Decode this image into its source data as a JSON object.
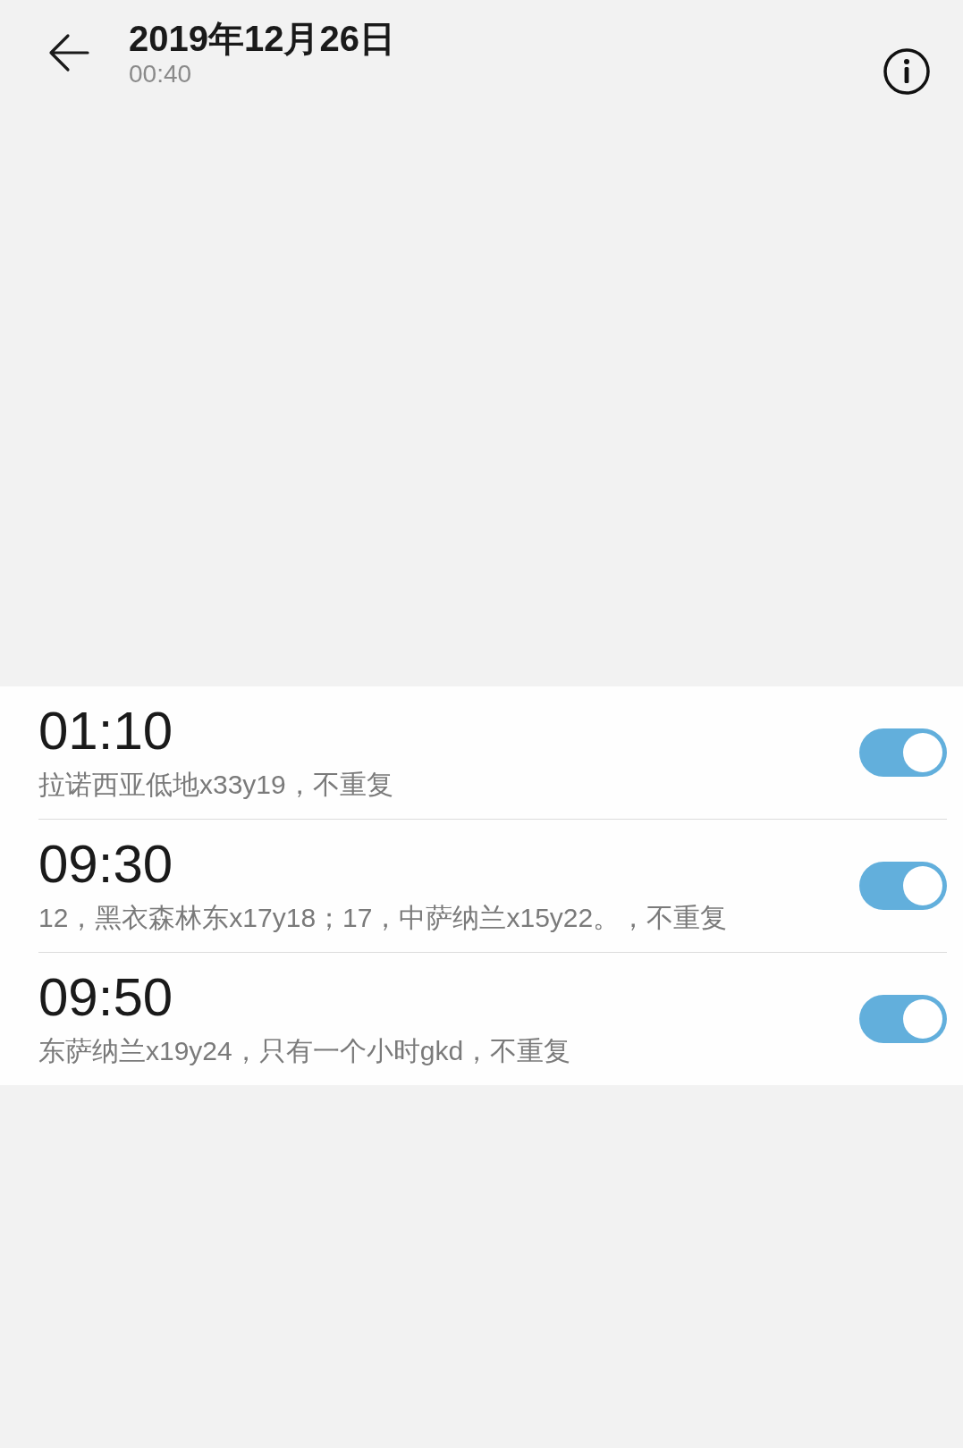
{
  "header": {
    "title": "2019年12月26日",
    "subtitle": "00:40"
  },
  "alarms": [
    {
      "time": "01:10",
      "description": "拉诺西亚低地x33y19，不重复",
      "on": true
    },
    {
      "time": "09:30",
      "description": "12，黑衣森林东x17y18；17，中萨纳兰x15y22。，不重复",
      "on": true
    },
    {
      "time": "09:50",
      "description": "东萨纳兰x19y24，只有一个小时gkd，不重复",
      "on": true
    }
  ]
}
